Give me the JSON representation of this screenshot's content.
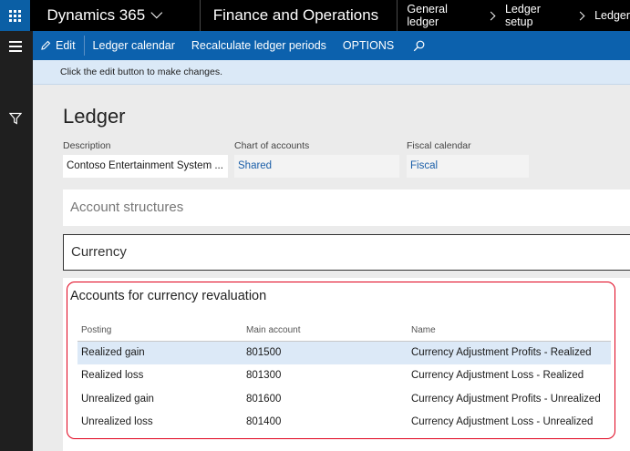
{
  "topbar": {
    "app_name": "Dynamics 365",
    "module_name": "Finance and Operations",
    "breadcrumb": [
      "General ledger",
      "Ledger setup",
      "Ledger"
    ]
  },
  "actions": {
    "edit": "Edit",
    "ledger_calendar": "Ledger calendar",
    "recalculate": "Recalculate ledger periods",
    "options": "OPTIONS"
  },
  "info_message": "Click the edit button to make changes.",
  "page": {
    "title": "Ledger",
    "fields": [
      {
        "label": "Description",
        "value": "Contoso Entertainment System ..."
      },
      {
        "label": "Chart of accounts",
        "value": "Shared"
      },
      {
        "label": "Fiscal calendar",
        "value": "Fiscal"
      }
    ],
    "sections": {
      "account_structures": "Account structures",
      "currency": "Currency",
      "revaluation": "Accounts for currency revaluation"
    }
  },
  "table": {
    "headers": [
      "Posting",
      "Main account",
      "Name"
    ],
    "rows": [
      [
        "Realized gain",
        "801500",
        "Currency Adjustment Profits - Realized"
      ],
      [
        "Realized loss",
        "801300",
        "Currency Adjustment Loss - Realized"
      ],
      [
        "Unrealized gain",
        "801600",
        "Currency Adjustment Profits - Unrealized"
      ],
      [
        "Unrealized loss",
        "801400",
        "Currency Adjustment Loss - Unrealized"
      ]
    ]
  },
  "colors": {
    "nav": "#000000",
    "waffle": "#0b5fa5",
    "action_pane": "#0c61ad",
    "info_bar": "#dbe9f7",
    "selected_row": "#dce9f7",
    "highlight_border": "#e0001b"
  }
}
